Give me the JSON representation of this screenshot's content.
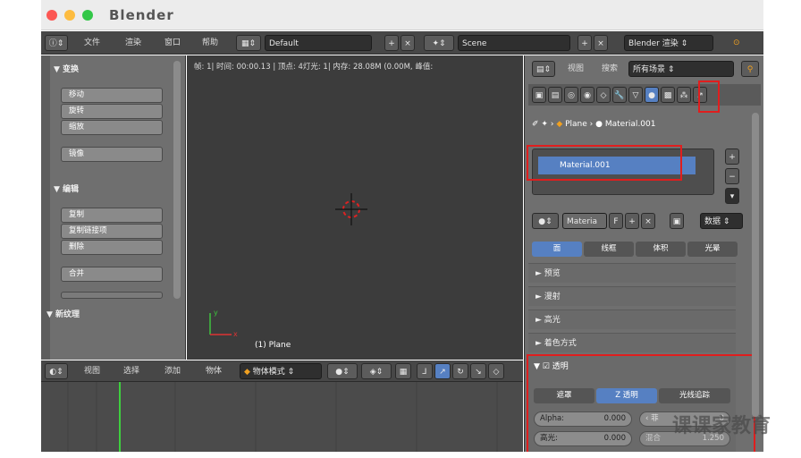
{
  "window": {
    "title": "Blender"
  },
  "header": {
    "menus": [
      "文件",
      "渲染",
      "窗口",
      "帮助"
    ],
    "layout": "Default",
    "scene": "Scene",
    "engine": "Blender 渲染"
  },
  "toolshelf": {
    "transform_title": "▼ 变换",
    "transform_buttons": [
      "移动",
      "旋转",
      "缩放"
    ],
    "mirror": "镜像",
    "edit_title": "▼ 编辑",
    "edit_buttons": [
      "复制",
      "复制链接项",
      "删除"
    ],
    "join": "合并",
    "new_texture": "▼ 新纹理"
  },
  "viewport": {
    "info": "帧: 1| 时间: 00:00.13 | 顶点: 4灯光: 1| 内存: 28.08M (0.00M, 峰值:",
    "object_label": "(1) Plane"
  },
  "timeline": {
    "menus": [
      "视图",
      "选择",
      "添加",
      "物体"
    ],
    "mode": "物体模式"
  },
  "properties": {
    "header_view": "视图",
    "header_search": "搜索",
    "header_scope": "所有场景",
    "breadcrumb_object": "Plane",
    "breadcrumb_material": "Material.001",
    "material_slot": "Material.001",
    "material_name": "Materia",
    "fake_user": "F",
    "data_label": "数据",
    "tabs": [
      "面",
      "线框",
      "体积",
      "光晕"
    ],
    "sections": [
      "► 预览",
      "► 漫射",
      "► 高光",
      "► 着色方式"
    ],
    "transparency": "透明",
    "trans_tabs": [
      "遮罩",
      "Z 透明",
      "光线追踪"
    ],
    "alpha_label": "Alpha:",
    "alpha_value": "0.000",
    "fresnel_label": "菲",
    "fresnel_value": "0",
    "specular_label": "高光:",
    "specular_value": "0.000",
    "blend_label": "混合",
    "blend_value": "1.250"
  },
  "watermark": "课课家教育",
  "colors": {
    "highlight": "#e01e1e",
    "selected": "#5680c2",
    "timeline_cursor": "#3ecf3e"
  }
}
